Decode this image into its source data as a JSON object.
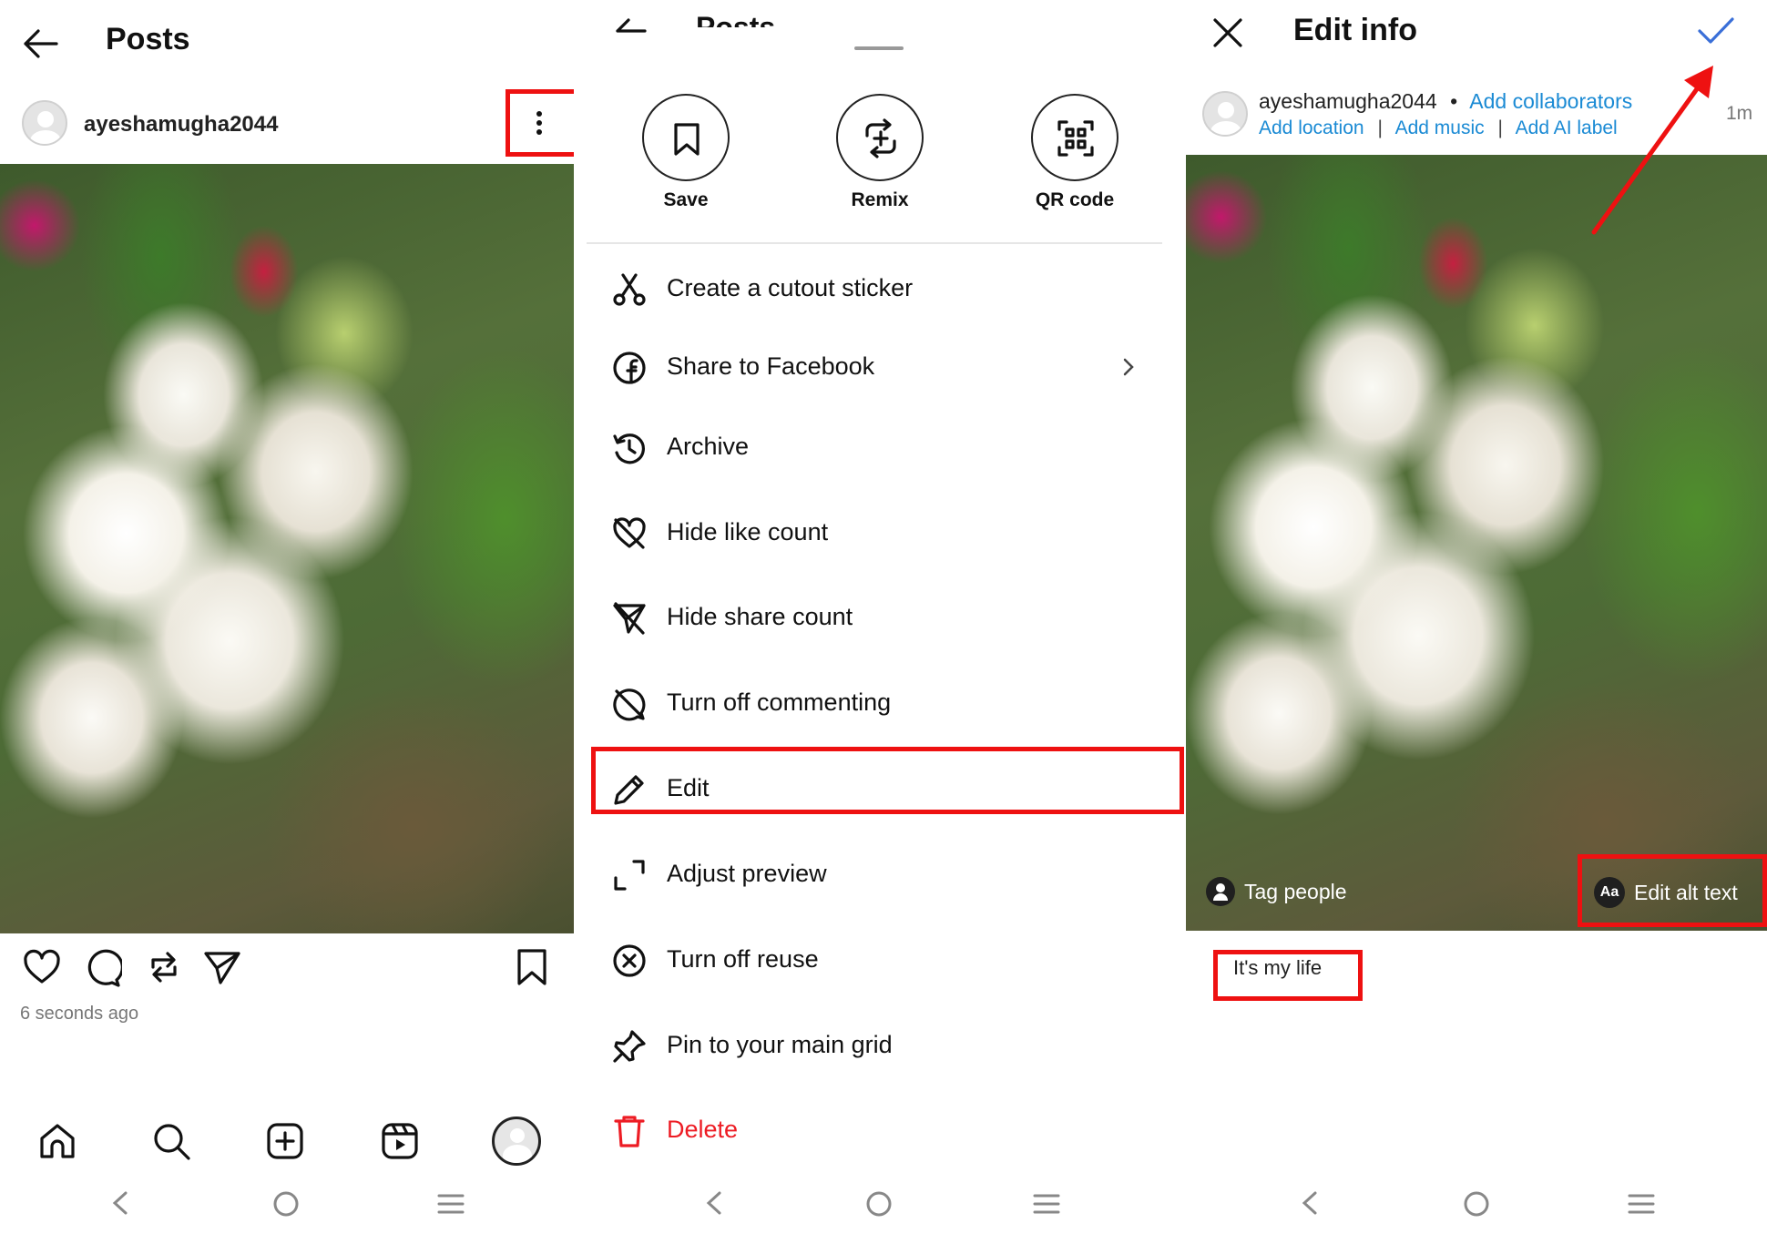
{
  "panel1": {
    "title": "Posts",
    "username": "ayeshamugha2044",
    "timestamp": "6 seconds ago",
    "icons": [
      "back-arrow-icon",
      "more-vertical-icon",
      "heart-icon",
      "comment-icon",
      "repost-icon",
      "share-icon",
      "bookmark-icon"
    ],
    "nav_icons": [
      "home-icon",
      "search-icon",
      "create-icon",
      "reels-icon",
      "profile-avatar"
    ]
  },
  "panel2": {
    "bg_title": "Posts",
    "top_actions": [
      {
        "label": "Save",
        "icon": "bookmark-icon"
      },
      {
        "label": "Remix",
        "icon": "remix-icon"
      },
      {
        "label": "QR code",
        "icon": "qr-code-icon"
      }
    ],
    "menu": [
      {
        "label": "Create a cutout sticker",
        "icon": "scissors-icon"
      },
      {
        "label": "Share to Facebook",
        "icon": "facebook-icon"
      },
      {
        "label": "Archive",
        "icon": "archive-icon"
      },
      {
        "label": "Hide like count",
        "icon": "hide-like-icon"
      },
      {
        "label": "Hide share count",
        "icon": "hide-share-icon"
      },
      {
        "label": "Turn off commenting",
        "icon": "comment-off-icon"
      },
      {
        "label": "Edit",
        "icon": "pencil-icon"
      },
      {
        "label": "Adjust preview",
        "icon": "adjust-icon"
      },
      {
        "label": "Turn off reuse",
        "icon": "reuse-off-icon"
      },
      {
        "label": "Pin to your main grid",
        "icon": "pin-icon"
      },
      {
        "label": "Delete",
        "icon": "trash-icon"
      }
    ],
    "delete_color": "#ed1c24"
  },
  "panel3": {
    "title": "Edit info",
    "username": "ayeshamugha2044",
    "separator": "•",
    "add_collaborators": "Add collaborators",
    "add_location": "Add location",
    "add_music": "Add music",
    "add_ai_label": "Add AI label",
    "divider": "|",
    "time": "1m",
    "tag_people": "Tag people",
    "edit_alt_text": "Edit alt text",
    "alt_badge": "Aa",
    "caption": "It's my life",
    "accent": "#3a6fd8",
    "link_color": "#1a8ad4"
  },
  "highlight_color": "#ee1111"
}
